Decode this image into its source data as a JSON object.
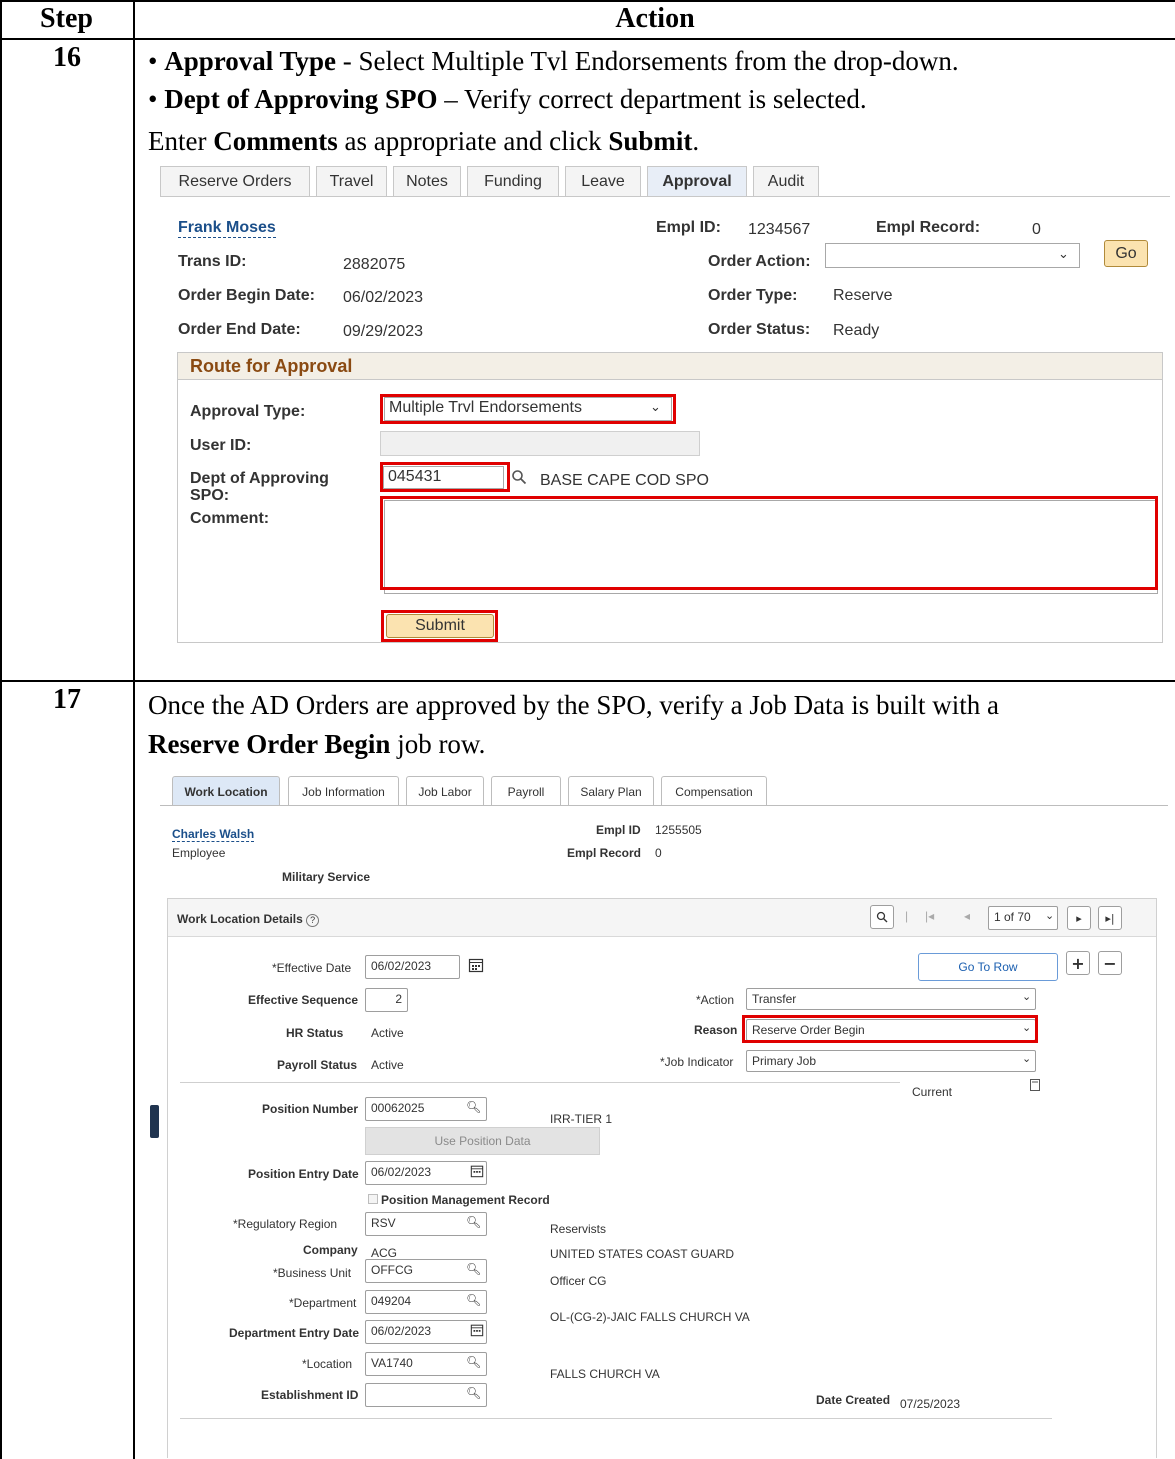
{
  "table": {
    "header_step": "Step",
    "header_action": "Action"
  },
  "step16": {
    "number": "16",
    "bullet1_bold": "Approval Type",
    "bullet1_rest": " - Select Multiple Tvl Endorsements from the drop-down.",
    "bullet2_bold": "Dept of Approving SPO",
    "bullet2_rest": " – Verify correct department is selected.",
    "line3_a": "Enter ",
    "line3_b": "Comments",
    "line3_c": " as appropriate and click ",
    "line3_d": "Submit",
    "line3_e": ".",
    "tabs": [
      "Reserve Orders",
      "Travel",
      "Notes",
      "Funding",
      "Leave",
      "Approval",
      "Audit"
    ],
    "active_tab": "Approval",
    "employee_name": "Frank Moses",
    "empl_id_label": "Empl ID:",
    "empl_id": "1234567",
    "empl_record_label": "Empl Record:",
    "empl_record": "0",
    "trans_id_label": "Trans ID:",
    "trans_id": "2882075",
    "order_action_label": "Order Action:",
    "order_action_value": "",
    "go_label": "Go",
    "order_begin_label": "Order Begin Date:",
    "order_begin": "06/02/2023",
    "order_type_label": "Order Type:",
    "order_type": "Reserve",
    "order_end_label": "Order End Date:",
    "order_end": "09/29/2023",
    "order_status_label": "Order Status:",
    "order_status": "Ready",
    "route_title": "Route for Approval",
    "approval_type_label": "Approval Type:",
    "approval_type": "Multiple Trvl Endorsements",
    "user_id_label": "User ID:",
    "user_id": "",
    "dept_label_1": "Dept of Approving",
    "dept_label_2": "SPO:",
    "dept_value": "045431",
    "dept_desc": "BASE CAPE COD SPO",
    "comment_label": "Comment:",
    "comment_value": "",
    "submit_label": "Submit"
  },
  "step17": {
    "number": "17",
    "text_line1": "Once the AD Orders are approved by the SPO, verify a Job Data is built with a",
    "text_line2_bold": "Reserve Order Begin",
    "text_line2_rest": " job row.",
    "tabs": [
      "Work Location",
      "Job Information",
      "Job Labor",
      "Payroll",
      "Salary Plan",
      "Compensation"
    ],
    "employee_name": "Charles Walsh",
    "employee_type": "Employee",
    "empl_id_label": "Empl ID",
    "empl_id": "1255505",
    "empl_record_label": "Empl Record",
    "empl_record": "0",
    "military_service": "Military Service",
    "section_title": "Work Location Details",
    "row_counter": "1 of 70",
    "effective_date_label": "*Effective Date",
    "effective_date": "06/02/2023",
    "go_to_row": "Go To Row",
    "eff_seq_label": "Effective Sequence",
    "eff_seq": "2",
    "action_label": "*Action",
    "action_value": "Transfer",
    "hr_status_label": "HR Status",
    "hr_status": "Active",
    "reason_label": "Reason",
    "reason_value": "Reserve Order Begin",
    "payroll_status_label": "Payroll Status",
    "payroll_status": "Active",
    "job_indicator_label": "*Job Indicator",
    "job_indicator": "Primary Job",
    "current_label": "Current",
    "position_number_label": "Position Number",
    "position_number": "00062025",
    "position_desc": "IRR-TIER 1",
    "use_position_data": "Use Position Data",
    "position_entry_label": "Position Entry Date",
    "position_entry": "06/02/2023",
    "position_mgmt_label": "Position Management Record",
    "reg_region_label": "*Regulatory Region",
    "reg_region": "RSV",
    "reg_region_desc": "Reservists",
    "company_label": "Company",
    "company": "ACG",
    "company_desc": "UNITED STATES COAST GUARD",
    "business_unit_label": "*Business Unit",
    "business_unit": "OFFCG",
    "business_unit_desc": "Officer CG",
    "department_label": "*Department",
    "department": "049204",
    "department_desc": "OL-(CG-2)-JAIC FALLS CHURCH VA",
    "dept_entry_label": "Department Entry Date",
    "dept_entry": "06/02/2023",
    "location_label": "*Location",
    "location": "VA1740",
    "location_desc": "FALLS CHURCH VA",
    "establishment_label": "Establishment ID",
    "establishment": "",
    "date_created_label": "Date Created",
    "date_created": "07/25/2023"
  }
}
